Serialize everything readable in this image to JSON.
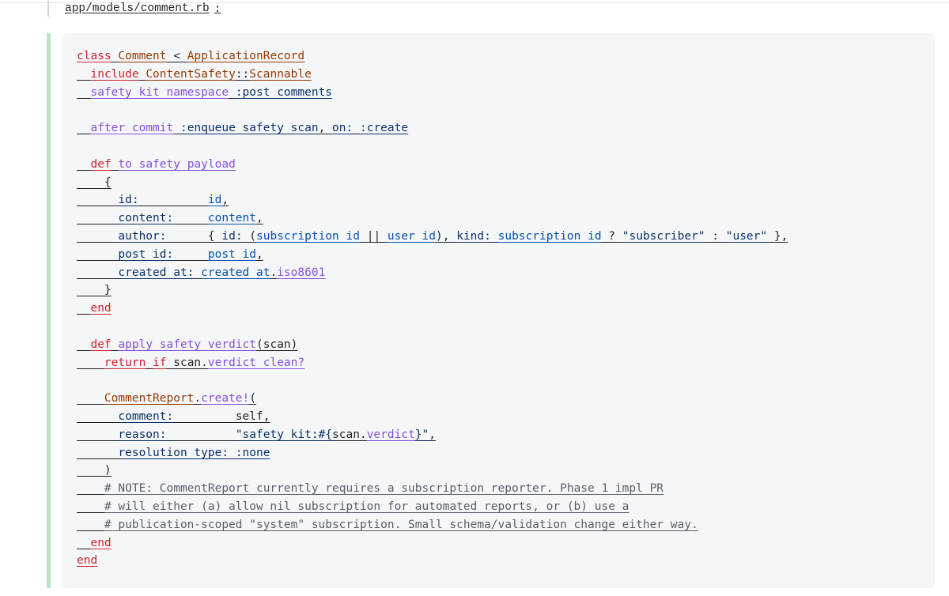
{
  "file": {
    "path": "app/models/comment.rb",
    "colon": ":"
  },
  "code_lines": [
    [
      [
        "kw",
        "class"
      ],
      [
        "ws",
        " "
      ],
      [
        "cls",
        "Comment"
      ],
      [
        "ws",
        " < "
      ],
      [
        "cls",
        "ApplicationRecord"
      ]
    ],
    [
      [
        "ws",
        "  "
      ],
      [
        "kw",
        "include"
      ],
      [
        "ws",
        " "
      ],
      [
        "cls",
        "ContentSafety"
      ],
      [
        "op",
        "::"
      ],
      [
        "cls",
        "Scannable"
      ]
    ],
    [
      [
        "ws",
        "  "
      ],
      [
        "fn",
        "safety_kit_namespace"
      ],
      [
        "ws",
        " "
      ],
      [
        "sym",
        ":post_comments"
      ]
    ],
    [],
    [
      [
        "ws",
        "  "
      ],
      [
        "fn",
        "after_commit"
      ],
      [
        "ws",
        " "
      ],
      [
        "sym",
        ":enqueue_safety_scan"
      ],
      [
        "op",
        ", "
      ],
      [
        "sym",
        "on:"
      ],
      [
        "ws",
        " "
      ],
      [
        "sym",
        ":create"
      ]
    ],
    [],
    [
      [
        "ws",
        "  "
      ],
      [
        "kw",
        "def"
      ],
      [
        "ws",
        " "
      ],
      [
        "fn",
        "to_safety_payload"
      ]
    ],
    [
      [
        "ws",
        "    "
      ],
      [
        "op",
        "{"
      ]
    ],
    [
      [
        "ws",
        "      "
      ],
      [
        "sym",
        "id:"
      ],
      [
        "ws",
        "          "
      ],
      [
        "var",
        "id"
      ],
      [
        "op",
        ","
      ]
    ],
    [
      [
        "ws",
        "      "
      ],
      [
        "sym",
        "content:"
      ],
      [
        "ws",
        "     "
      ],
      [
        "var",
        "content"
      ],
      [
        "op",
        ","
      ]
    ],
    [
      [
        "ws",
        "      "
      ],
      [
        "sym",
        "author:"
      ],
      [
        "ws",
        "      "
      ],
      [
        "op",
        "{ "
      ],
      [
        "sym",
        "id:"
      ],
      [
        "ws",
        " ("
      ],
      [
        "var",
        "subscription_id"
      ],
      [
        "ws",
        " || "
      ],
      [
        "var",
        "user_id"
      ],
      [
        "op",
        "), "
      ],
      [
        "sym",
        "kind:"
      ],
      [
        "ws",
        " "
      ],
      [
        "var",
        "subscription_id"
      ],
      [
        "ws",
        " ? "
      ],
      [
        "str",
        "\"subscriber\""
      ],
      [
        "ws",
        " : "
      ],
      [
        "str",
        "\"user\""
      ],
      [
        "op",
        " },"
      ]
    ],
    [
      [
        "ws",
        "      "
      ],
      [
        "sym",
        "post_id:"
      ],
      [
        "ws",
        "     "
      ],
      [
        "var",
        "post_id"
      ],
      [
        "op",
        ","
      ]
    ],
    [
      [
        "ws",
        "      "
      ],
      [
        "sym",
        "created_at:"
      ],
      [
        "ws",
        " "
      ],
      [
        "var",
        "created_at"
      ],
      [
        "op",
        "."
      ],
      [
        "fn",
        "iso8601"
      ]
    ],
    [
      [
        "ws",
        "    "
      ],
      [
        "op",
        "}"
      ]
    ],
    [
      [
        "ws",
        "  "
      ],
      [
        "kw",
        "end"
      ]
    ],
    [],
    [
      [
        "ws",
        "  "
      ],
      [
        "kw",
        "def"
      ],
      [
        "ws",
        " "
      ],
      [
        "fn",
        "apply_safety_verdict"
      ],
      [
        "op",
        "(scan)"
      ]
    ],
    [
      [
        "ws",
        "    "
      ],
      [
        "kw",
        "return"
      ],
      [
        "ws",
        " "
      ],
      [
        "kw",
        "if"
      ],
      [
        "ws",
        " scan."
      ],
      [
        "fn",
        "verdict_clean?"
      ]
    ],
    [],
    [
      [
        "ws",
        "    "
      ],
      [
        "cls",
        "CommentReport"
      ],
      [
        "op",
        "."
      ],
      [
        "fn",
        "create!"
      ],
      [
        "op",
        "("
      ]
    ],
    [
      [
        "ws",
        "      "
      ],
      [
        "sym",
        "comment:"
      ],
      [
        "ws",
        "         "
      ],
      [
        "ws",
        "self"
      ],
      [
        "op",
        ","
      ]
    ],
    [
      [
        "ws",
        "      "
      ],
      [
        "sym",
        "reason:"
      ],
      [
        "ws",
        "          "
      ],
      [
        "str",
        "\"safety_kit:#{"
      ],
      [
        "ws",
        "scan."
      ],
      [
        "fn",
        "verdict"
      ],
      [
        "str",
        "}\""
      ],
      [
        "op",
        ","
      ]
    ],
    [
      [
        "ws",
        "      "
      ],
      [
        "sym",
        "resolution_type:"
      ],
      [
        "ws",
        " "
      ],
      [
        "sym",
        ":none"
      ]
    ],
    [
      [
        "ws",
        "    "
      ],
      [
        "op",
        ")"
      ]
    ],
    [
      [
        "ws",
        "    "
      ],
      [
        "cm",
        "# NOTE: CommentReport currently requires a subscription reporter. Phase 1 impl PR"
      ]
    ],
    [
      [
        "ws",
        "    "
      ],
      [
        "cm",
        "# will either (a) allow nil subscription for automated reports, or (b) use a"
      ]
    ],
    [
      [
        "ws",
        "    "
      ],
      [
        "cm",
        "# publication-scoped \"system\" subscription. Small schema/validation change either way."
      ]
    ],
    [
      [
        "ws",
        "  "
      ],
      [
        "kw",
        "end"
      ]
    ],
    [
      [
        "kw",
        "end"
      ]
    ]
  ],
  "colors": {
    "keyword": "#cf222e",
    "class": "#953800",
    "symbol": "#0a3069",
    "method": "#8250df",
    "comment": "#57606a",
    "quote_bar": "#b7e4c5",
    "panel_bg": "#f5f6f8"
  }
}
